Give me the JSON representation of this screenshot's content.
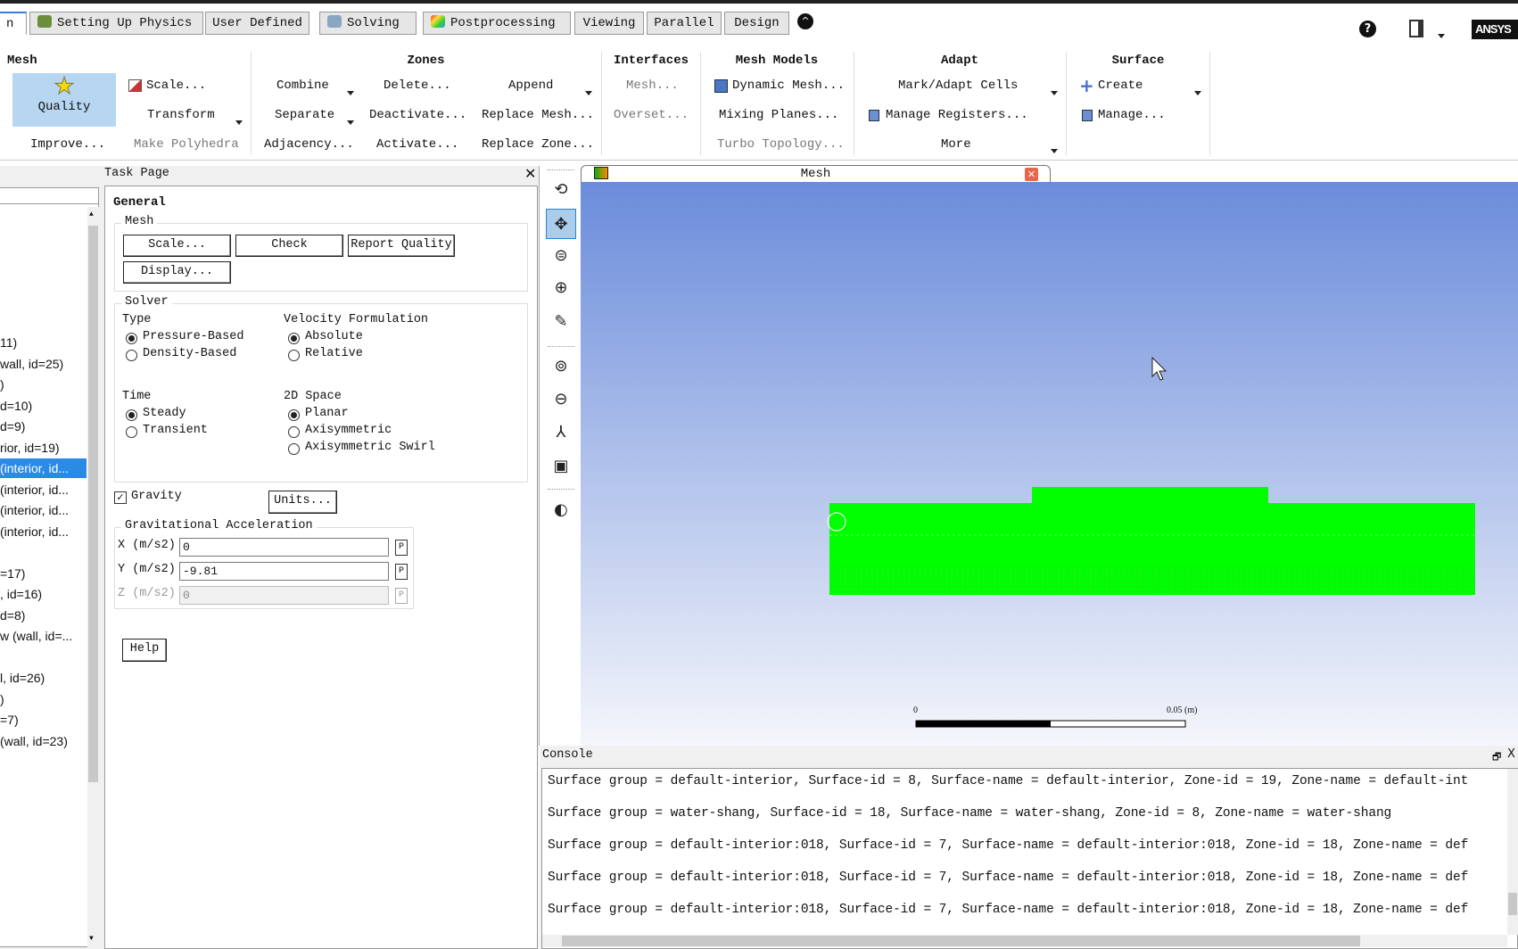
{
  "tabs": [
    {
      "label": "n",
      "active": true
    },
    {
      "label": "Setting Up Physics",
      "icon": "physics-icon"
    },
    {
      "label": "User Defined"
    },
    {
      "label": "Solving",
      "icon": "solving-icon"
    },
    {
      "label": "Postprocessing",
      "icon": "postprocessing-icon"
    },
    {
      "label": "Viewing"
    },
    {
      "label": "Parallel"
    },
    {
      "label": "Design"
    }
  ],
  "topright": {
    "help_icon": "question-icon",
    "layout_icon": "layout-icon",
    "logo": "ANSYS"
  },
  "ribbon": {
    "mesh": {
      "title": "Mesh",
      "quality": "Quality",
      "scale": "Scale...",
      "transform": "Transform",
      "improve": "Improve...",
      "make_polyhedra": "Make Polyhedra"
    },
    "zones": {
      "title": "Zones",
      "combine": "Combine",
      "delete": "Delete...",
      "append": "Append",
      "separate": "Separate",
      "deactivate": "Deactivate...",
      "replace_mesh": "Replace Mesh...",
      "adjacency": "Adjacency...",
      "activate": "Activate...",
      "replace_zone": "Replace Zone..."
    },
    "interfaces": {
      "title": "Interfaces",
      "mesh": "Mesh...",
      "overset": "Overset..."
    },
    "mesh_models": {
      "title": "Mesh Models",
      "dynamic_mesh": "Dynamic Mesh...",
      "mixing_planes": "Mixing Planes...",
      "turbo_topology": "Turbo Topology..."
    },
    "adapt": {
      "title": "Adapt",
      "mark_adapt": "Mark/Adapt Cells",
      "manage_registers": "Manage Registers...",
      "more": "More"
    },
    "surface": {
      "title": "Surface",
      "create": "Create",
      "manage": "Manage..."
    }
  },
  "tree": {
    "items": [
      "11)",
      "wall, id=25)",
      ")",
      "d=10)",
      "d=9)",
      "rior, id=19)",
      " (interior, id...",
      " (interior, id...",
      " (interior, id...",
      " (interior, id...",
      "",
      "=17)",
      ", id=16)",
      "d=8)",
      "w (wall, id=...",
      "",
      "l, id=26)",
      ")",
      "=7)",
      " (wall, id=23)"
    ],
    "selected_index": 6
  },
  "task_page": {
    "header": "Task Page",
    "title": "General",
    "mesh_group": "Mesh",
    "scale_btn": "Scale...",
    "check_btn": "Check",
    "report_quality_btn": "Report Quality",
    "display_btn": "Display...",
    "solver_group": "Solver",
    "type_label": "Type",
    "type_options": [
      "Pressure-Based",
      "Density-Based"
    ],
    "type_selected": "Pressure-Based",
    "velocity_label": "Velocity Formulation",
    "velocity_options": [
      "Absolute",
      "Relative"
    ],
    "velocity_selected": "Absolute",
    "time_label": "Time",
    "time_options": [
      "Steady",
      "Transient"
    ],
    "time_selected": "Steady",
    "space_label": "2D Space",
    "space_options": [
      "Planar",
      "Axisymmetric",
      "Axisymmetric Swirl"
    ],
    "space_selected": "Planar",
    "gravity_label": "Gravity",
    "gravity_checked": true,
    "units_btn": "Units...",
    "grav_group": "Gravitational Acceleration",
    "x_label": "X (m/s2)",
    "x_value": "0",
    "y_label": "Y (m/s2)",
    "y_value": "-9.81",
    "z_label": "Z (m/s2)",
    "z_value": "0",
    "p_label": "P",
    "help_btn": "Help"
  },
  "graphics": {
    "tab_title": "Mesh",
    "tools": [
      "rotate-icon",
      "pan-icon",
      "zoom-in-out-icon",
      "zoom-box-icon",
      "probe-icon",
      "fit-to-window-icon",
      "zoom-out-icon",
      "axes-icon",
      "camera-icon",
      "view-options-icon"
    ],
    "scale_zero": "0",
    "scale_max": "0.05 (m)",
    "mesh_color": "#00ff00",
    "bg_top": "#6b8cdb",
    "bg_bottom": "#f4f6fb"
  },
  "console": {
    "title": "Console",
    "lines": [
      "Surface group = default-interior, Surface-id = 8, Surface-name = default-interior, Zone-id = 19, Zone-name = default-int",
      "Surface group = water-shang, Surface-id = 18, Surface-name = water-shang, Zone-id = 8, Zone-name = water-shang",
      "Surface group = default-interior:018, Surface-id = 7, Surface-name = default-interior:018, Zone-id = 18, Zone-name = def",
      "Surface group = default-interior:018, Surface-id = 7, Surface-name = default-interior:018, Zone-id = 18, Zone-name = def",
      "Surface group = default-interior:018, Surface-id = 7, Surface-name = default-interior:018, Zone-id = 18, Zone-name = def"
    ]
  }
}
